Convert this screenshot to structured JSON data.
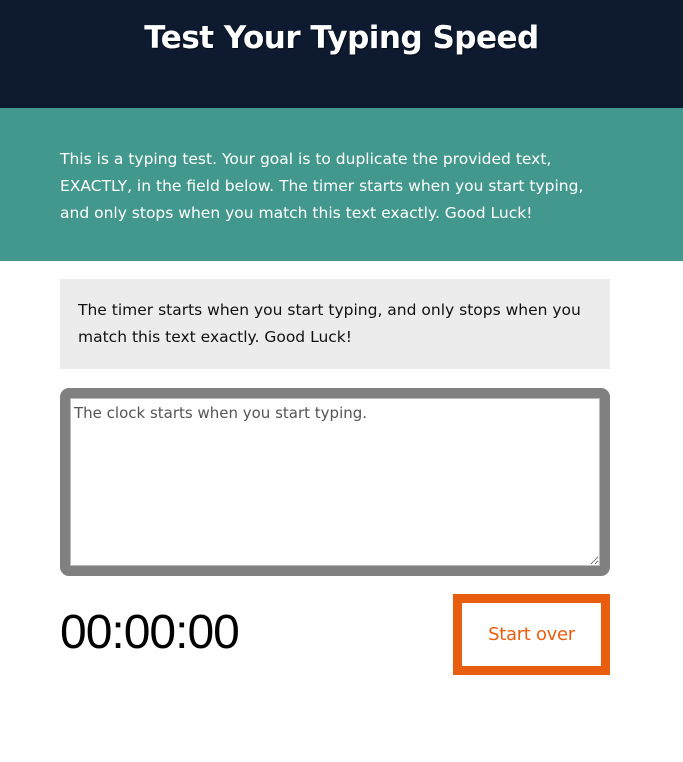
{
  "header": {
    "title": "Test Your Typing Speed"
  },
  "intro": {
    "text": "This is a typing test. Your goal is to duplicate the provided text, EXACTLY, in the field below. The timer starts when you start typing, and only stops when you match this text exactly. Good Luck!"
  },
  "origin": {
    "text": "The timer starts when you start typing, and only stops when you match this text exactly. Good Luck!"
  },
  "input": {
    "value": "",
    "placeholder": "The clock starts when you start typing."
  },
  "timer": {
    "value": "00:00:00"
  },
  "reset_button": {
    "label": "Start over"
  },
  "colors": {
    "header_bg": "#0d1a30",
    "intro_bg": "#43988d",
    "origin_bg": "#ececec",
    "textarea_border": "#808080",
    "accent": "#e95d0f"
  }
}
